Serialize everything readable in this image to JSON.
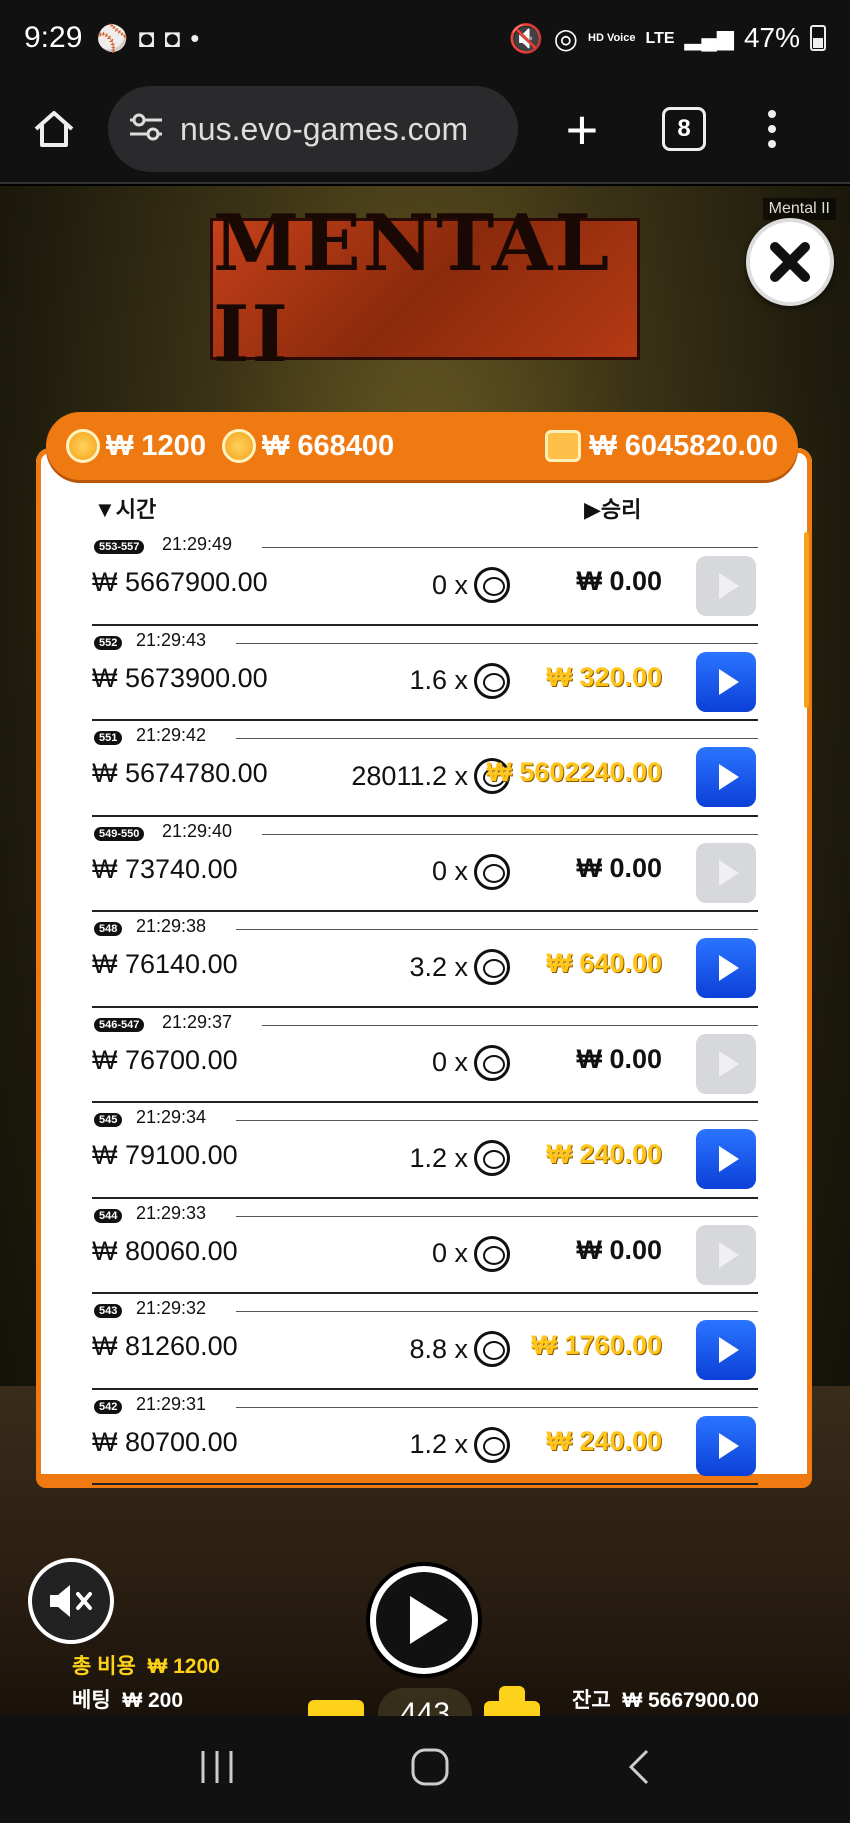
{
  "status_bar": {
    "time": "9:29",
    "network": "LTE",
    "hd_voice": "HD Voice",
    "battery": "47%"
  },
  "browser": {
    "url": "nus.evo-games.com",
    "tab_count": "8"
  },
  "game": {
    "title": "MENTAL II",
    "window_label": "Mental II",
    "header": {
      "bet_total": "₩ 1200",
      "coins": "₩ 668400",
      "wallet": "₩ 6045820.00"
    },
    "columns": {
      "time": "시간",
      "win": "승리"
    },
    "rows": [
      {
        "badge": "553-557",
        "time": "21:29:49",
        "balance": "₩ 5667900.00",
        "multiplier": "0 x",
        "win": "₩ 0.00",
        "won": false
      },
      {
        "badge": "552",
        "time": "21:29:43",
        "balance": "₩ 5673900.00",
        "multiplier": "1.6 x",
        "win": "₩ 320.00",
        "won": true
      },
      {
        "badge": "551",
        "time": "21:29:42",
        "balance": "₩ 5674780.00",
        "multiplier": "28011.2 x",
        "win": "₩ 5602240.00",
        "won": true
      },
      {
        "badge": "549-550",
        "time": "21:29:40",
        "balance": "₩ 73740.00",
        "multiplier": "0 x",
        "win": "₩ 0.00",
        "won": false
      },
      {
        "badge": "548",
        "time": "21:29:38",
        "balance": "₩ 76140.00",
        "multiplier": "3.2 x",
        "win": "₩ 640.00",
        "won": true
      },
      {
        "badge": "546-547",
        "time": "21:29:37",
        "balance": "₩ 76700.00",
        "multiplier": "0 x",
        "win": "₩ 0.00",
        "won": false
      },
      {
        "badge": "545",
        "time": "21:29:34",
        "balance": "₩ 79100.00",
        "multiplier": "1.2 x",
        "win": "₩ 240.00",
        "won": true
      },
      {
        "badge": "544",
        "time": "21:29:33",
        "balance": "₩ 80060.00",
        "multiplier": "0 x",
        "win": "₩ 0.00",
        "won": false
      },
      {
        "badge": "543",
        "time": "21:29:32",
        "balance": "₩ 81260.00",
        "multiplier": "8.8 x",
        "win": "₩ 1760.00",
        "won": true
      },
      {
        "badge": "542",
        "time": "21:29:31",
        "balance": "₩ 80700.00",
        "multiplier": "1.2 x",
        "win": "₩ 240.00",
        "won": true
      }
    ],
    "spin_count": "443",
    "footer": {
      "total_cost_label": "총 비용",
      "total_cost_value": "₩ 1200",
      "bet_label": "베팅",
      "bet_value": "₩ 200",
      "balance_label": "잔고",
      "balance_value": "₩ 5667900.00"
    }
  },
  "colors": {
    "accent_orange": "#f07a12",
    "play_blue": "#1a58ee",
    "win_gold": "#ffc51a"
  },
  "icons": [
    "home-icon",
    "site-settings-icon",
    "new-tab-icon",
    "tab-switcher-icon",
    "more-menu-icon",
    "close-icon",
    "coin-icon",
    "wallet-icon",
    "play-icon",
    "mute-icon",
    "recent-apps-icon",
    "home-nav-icon",
    "back-icon"
  ]
}
